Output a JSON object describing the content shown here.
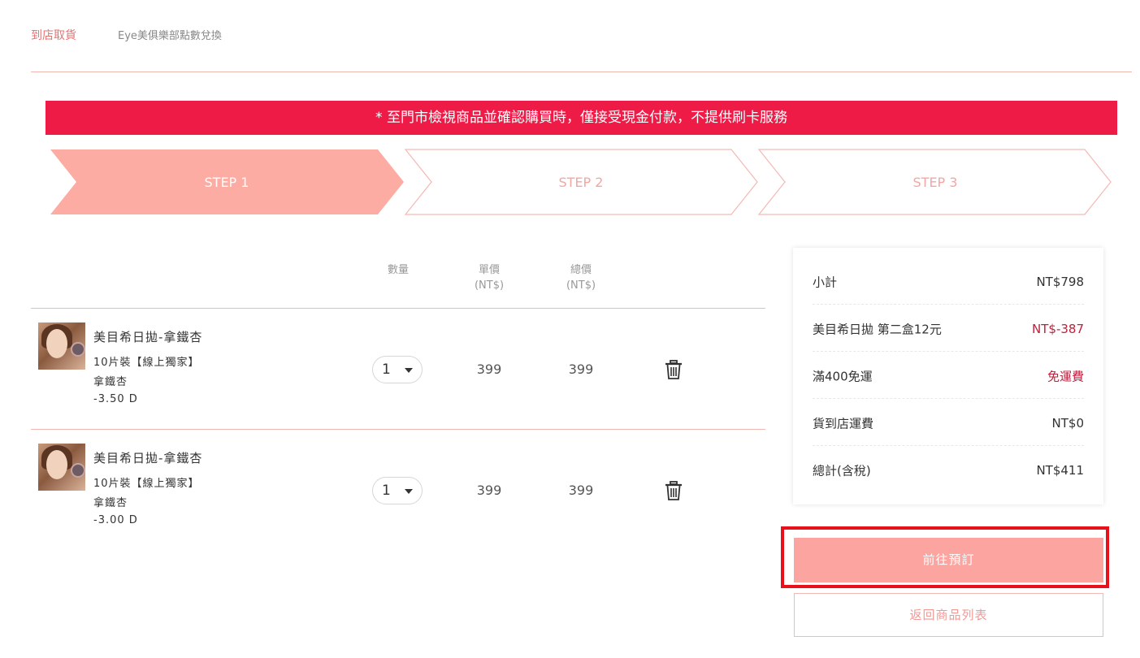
{
  "tabs": {
    "active": "到店取貨",
    "other": "Eye美俱樂部點數兌換"
  },
  "notice": "* 至門市檢視商品並確認購買時，僅接受現金付款，不提供刷卡服務",
  "steps": [
    "STEP 1",
    "STEP 2",
    "STEP 3"
  ],
  "columns": {
    "qty": "數量",
    "unit_price": "單價",
    "unit_price_currency": "(NT$)",
    "total_price": "總價",
    "total_price_currency": "(NT$)"
  },
  "items": [
    {
      "name": "美目希日拋-拿鐵杏",
      "pack": "10片裝【線上獨家】",
      "color": "拿鐵杏",
      "power": "-3.50 D",
      "qty": "1",
      "unit_price": "399",
      "total": "399"
    },
    {
      "name": "美目希日拋-拿鐵杏",
      "pack": "10片裝【線上獨家】",
      "color": "拿鐵杏",
      "power": "-3.00 D",
      "qty": "1",
      "unit_price": "399",
      "total": "399"
    }
  ],
  "summary": [
    {
      "label": "小計",
      "value": "NT$798"
    },
    {
      "label": "美目希日拋 第二盒12元",
      "value": "NT$-387"
    },
    {
      "label": "滿400免運",
      "value": "免運費"
    },
    {
      "label": "貨到店運費",
      "value": "NT$0"
    },
    {
      "label": "總計(含稅)",
      "value": "NT$411"
    }
  ],
  "buttons": {
    "reserve": "前往預訂",
    "back": "返回商品列表"
  },
  "colors": {
    "notice_bg": "#ee1b47",
    "step_active": "#fcaca3",
    "step_border": "#f6b8b3",
    "accent_red": "#c0203c",
    "reserve_btn": "#fca4a0",
    "highlight_box": "#e8111b"
  }
}
